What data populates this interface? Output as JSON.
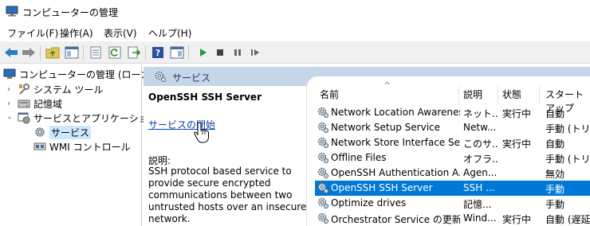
{
  "window": {
    "title": "コンピューターの管理"
  },
  "menu": [
    "ファイル(F)",
    "操作(A)",
    "表示(V)",
    "ヘルプ(H)"
  ],
  "toolbar": {
    "buttons": [
      "back-arrow-icon",
      "forward-arrow-icon",
      "folder-up-icon",
      "console-tree-icon",
      "properties-icon",
      "refresh-icon",
      "export-list-icon",
      "help-icon",
      "action-pane-icon",
      "start-service-icon",
      "stop-service-icon",
      "pause-service-icon",
      "restart-service-icon"
    ]
  },
  "tree": {
    "root": "コンピューターの管理 (ローカル)",
    "items": [
      {
        "label": "システム ツール"
      },
      {
        "label": "記憶域"
      },
      {
        "label": "サービスとアプリケーション"
      },
      {
        "label": "サービス"
      },
      {
        "label": "WMI コントロール"
      }
    ]
  },
  "pane": {
    "title": "サービス"
  },
  "extended": {
    "service_name": "OpenSSH SSH Server",
    "start_link": "サービスの開始",
    "desc_label": "説明:",
    "description": "SSH protocol based service to provide secure encrypted communications between two untrusted hosts over an insecure network."
  },
  "columns": [
    "名前",
    "説明",
    "状態",
    "スタートアップ"
  ],
  "services": [
    {
      "name": "Network Location Awareness",
      "desc": "ネット...",
      "status": "実行中",
      "startup": "自動"
    },
    {
      "name": "Network Setup Service",
      "desc": "Netw...",
      "status": "",
      "startup": "手動 (トリ"
    },
    {
      "name": "Network Store Interface Ser...",
      "desc": "このサ...",
      "status": "実行中",
      "startup": "自動"
    },
    {
      "name": "Offline Files",
      "desc": "オフラ...",
      "status": "",
      "startup": "手動 (トリ"
    },
    {
      "name": "OpenSSH Authentication A...",
      "desc": "Agen...",
      "status": "",
      "startup": "無効"
    },
    {
      "name": "OpenSSH SSH Server",
      "desc": "SSH ...",
      "status": "",
      "startup": "手動"
    },
    {
      "name": "Optimize drives",
      "desc": "記憶...",
      "status": "",
      "startup": "手動"
    },
    {
      "name": "Orchestrator Service の更新",
      "desc": "Wind...",
      "status": "実行中",
      "startup": "自動 (遅延"
    }
  ],
  "selected_service": "OpenSSH SSH Server",
  "colors": {
    "accent": "#0078d7",
    "header_bg": "#c5d6e9",
    "link": "#0645ad"
  }
}
